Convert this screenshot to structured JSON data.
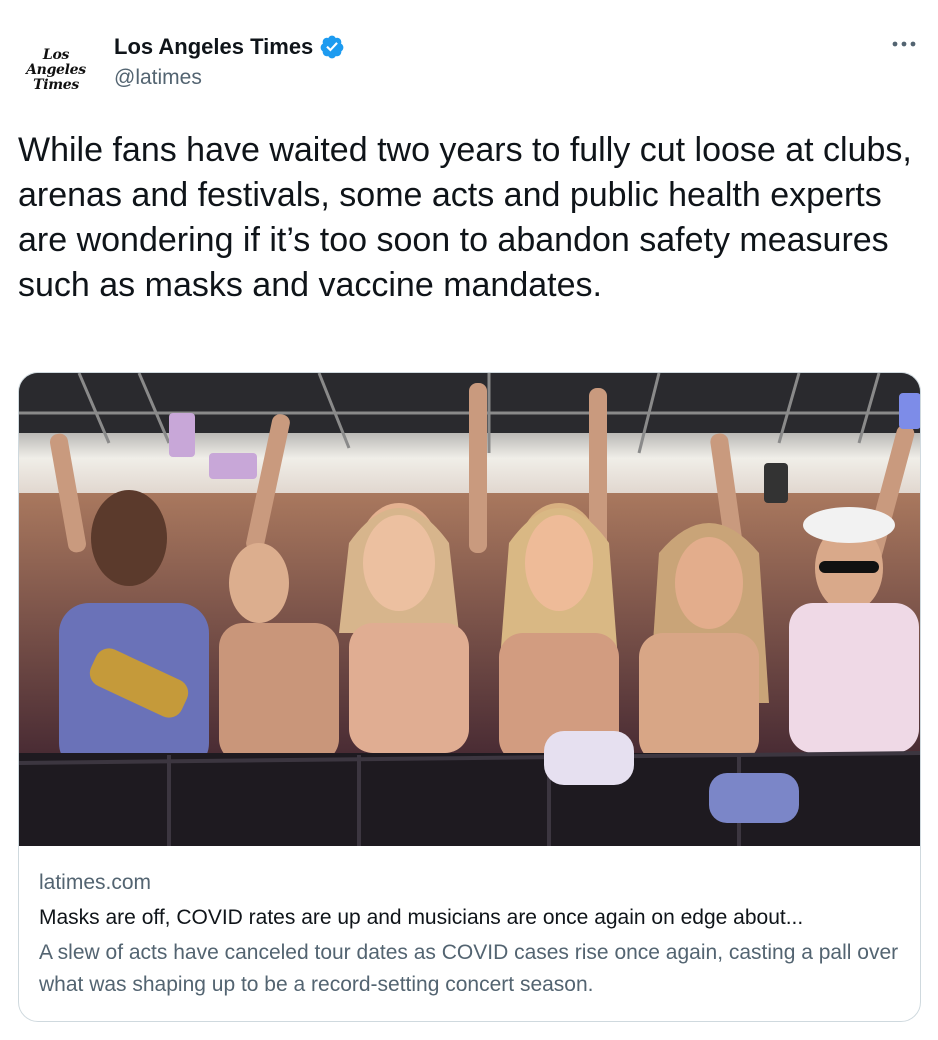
{
  "author": {
    "avatar_logo_lines": [
      "Los",
      "Angeles",
      "Times"
    ],
    "display_name": "Los Angeles Times",
    "handle": "@latimes",
    "verified": true,
    "more_icon": "more-horizontal-icon"
  },
  "tweet": {
    "text": "While fans have waited two years to fully cut loose at clubs, arenas and festivals, some acts and public health experts are wondering if it’s too soon to abandon safety measures such as masks and vaccine mandates."
  },
  "link_card": {
    "domain": "latimes.com",
    "title": "Masks are off, COVID rates are up and musicians are once again on edge about...",
    "description": "A slew of acts have canceled tour dates as COVID cases rise once again, casting a pall over what was shaping up to be a record-setting concert season."
  },
  "colors": {
    "text_primary": "#0f1419",
    "text_secondary": "#536471",
    "verified_blue": "#1d9bf0",
    "card_border": "#cfd9de"
  }
}
